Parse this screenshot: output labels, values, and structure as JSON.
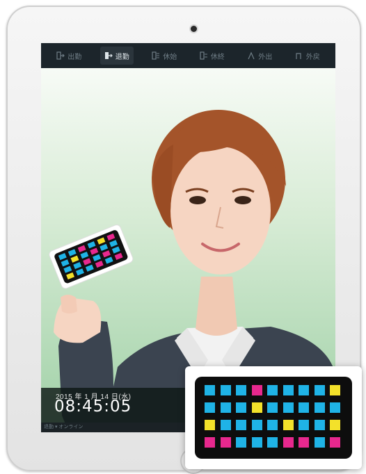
{
  "toolbar": {
    "items": [
      {
        "label": "出勤",
        "icon": "login-icon"
      },
      {
        "label": "退勤",
        "icon": "logout-icon",
        "active": true
      },
      {
        "label": "休始",
        "icon": "break-start-icon"
      },
      {
        "label": "休終",
        "icon": "break-end-icon"
      },
      {
        "label": "外出",
        "icon": "go-out-icon"
      },
      {
        "label": "外戻",
        "icon": "return-icon"
      }
    ]
  },
  "clock": {
    "date": "2015 年 1 月 14 日(水)",
    "time": "08:45:05"
  },
  "statusbar": {
    "text": "退勤 ▾ オンライン"
  },
  "card": {
    "rows": [
      [
        "cyan",
        "cyan",
        "cyan",
        "magenta",
        "cyan",
        "cyan",
        "cyan",
        "cyan",
        "yellow"
      ],
      [
        "cyan",
        "cyan",
        "cyan",
        "yellow",
        "cyan",
        "cyan",
        "cyan",
        "cyan",
        "cyan"
      ],
      [
        "yellow",
        "cyan",
        "cyan",
        "cyan",
        "cyan",
        "yellow",
        "cyan",
        "cyan",
        "yellow"
      ],
      [
        "magenta",
        "magenta",
        "cyan",
        "cyan",
        "cyan",
        "magenta",
        "magenta",
        "cyan",
        "magenta"
      ]
    ],
    "colors": {
      "cyan": "#1fb3e6",
      "magenta": "#e8288e",
      "yellow": "#f3e12a",
      "background": "#0d0d0d"
    }
  },
  "held_card": {
    "rows": [
      [
        "cyan",
        "cyan",
        "magenta",
        "cyan",
        "yellow",
        "magenta"
      ],
      [
        "cyan",
        "yellow",
        "cyan",
        "magenta",
        "cyan",
        "cyan"
      ],
      [
        "cyan",
        "cyan",
        "magenta",
        "cyan",
        "magenta",
        "cyan"
      ],
      [
        "yellow",
        "cyan",
        "cyan",
        "magenta",
        "cyan",
        "magenta"
      ]
    ]
  }
}
